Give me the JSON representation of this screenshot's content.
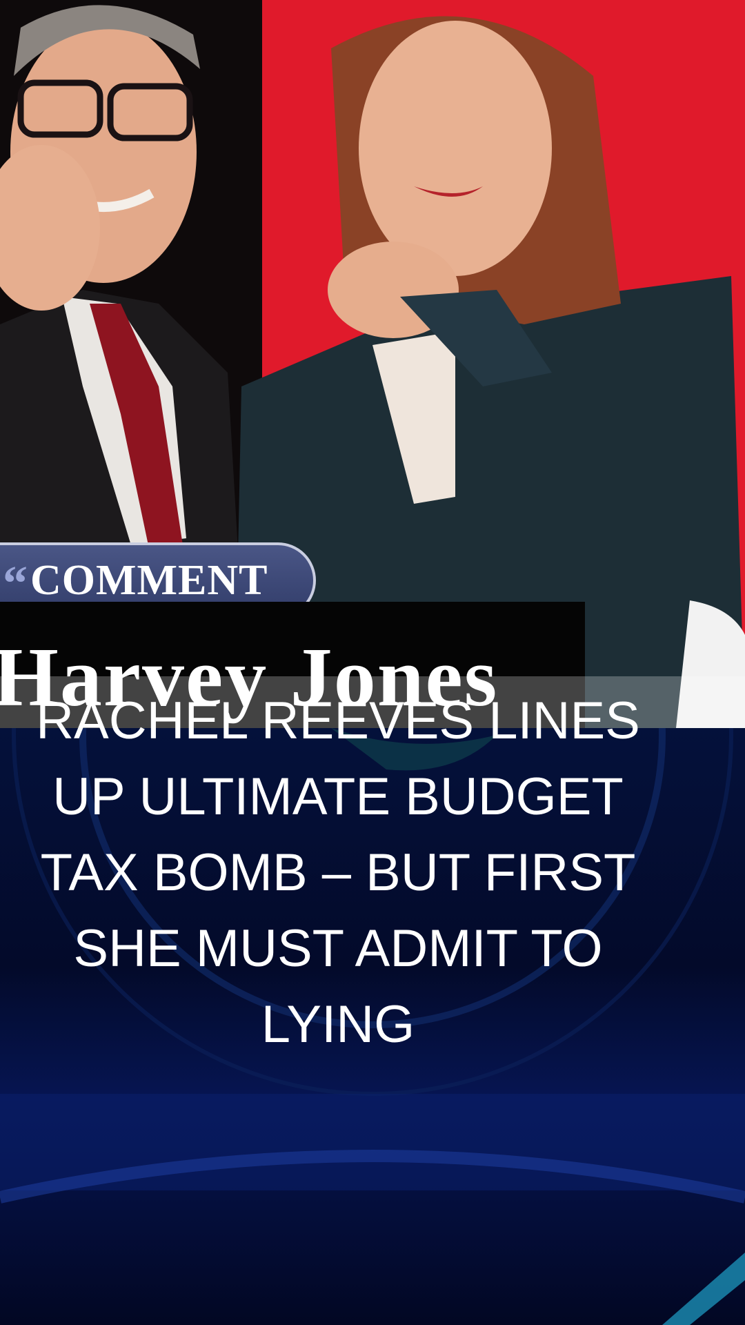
{
  "badge": {
    "quote_mark": "“",
    "label": "COMMENT"
  },
  "byline": {
    "author": "Harvey Jones"
  },
  "headline": {
    "text": "RACHEL REEVES LINES UP ULTIMATE BUDGET TAX BOMB – BUT FIRST SHE MUST ADMIT TO LYING"
  },
  "colors": {
    "backdrop_red": "#e01a2b",
    "navy_background": "#04113b",
    "badge_fill": "#3e4a7a",
    "text_white": "#ffffff"
  }
}
